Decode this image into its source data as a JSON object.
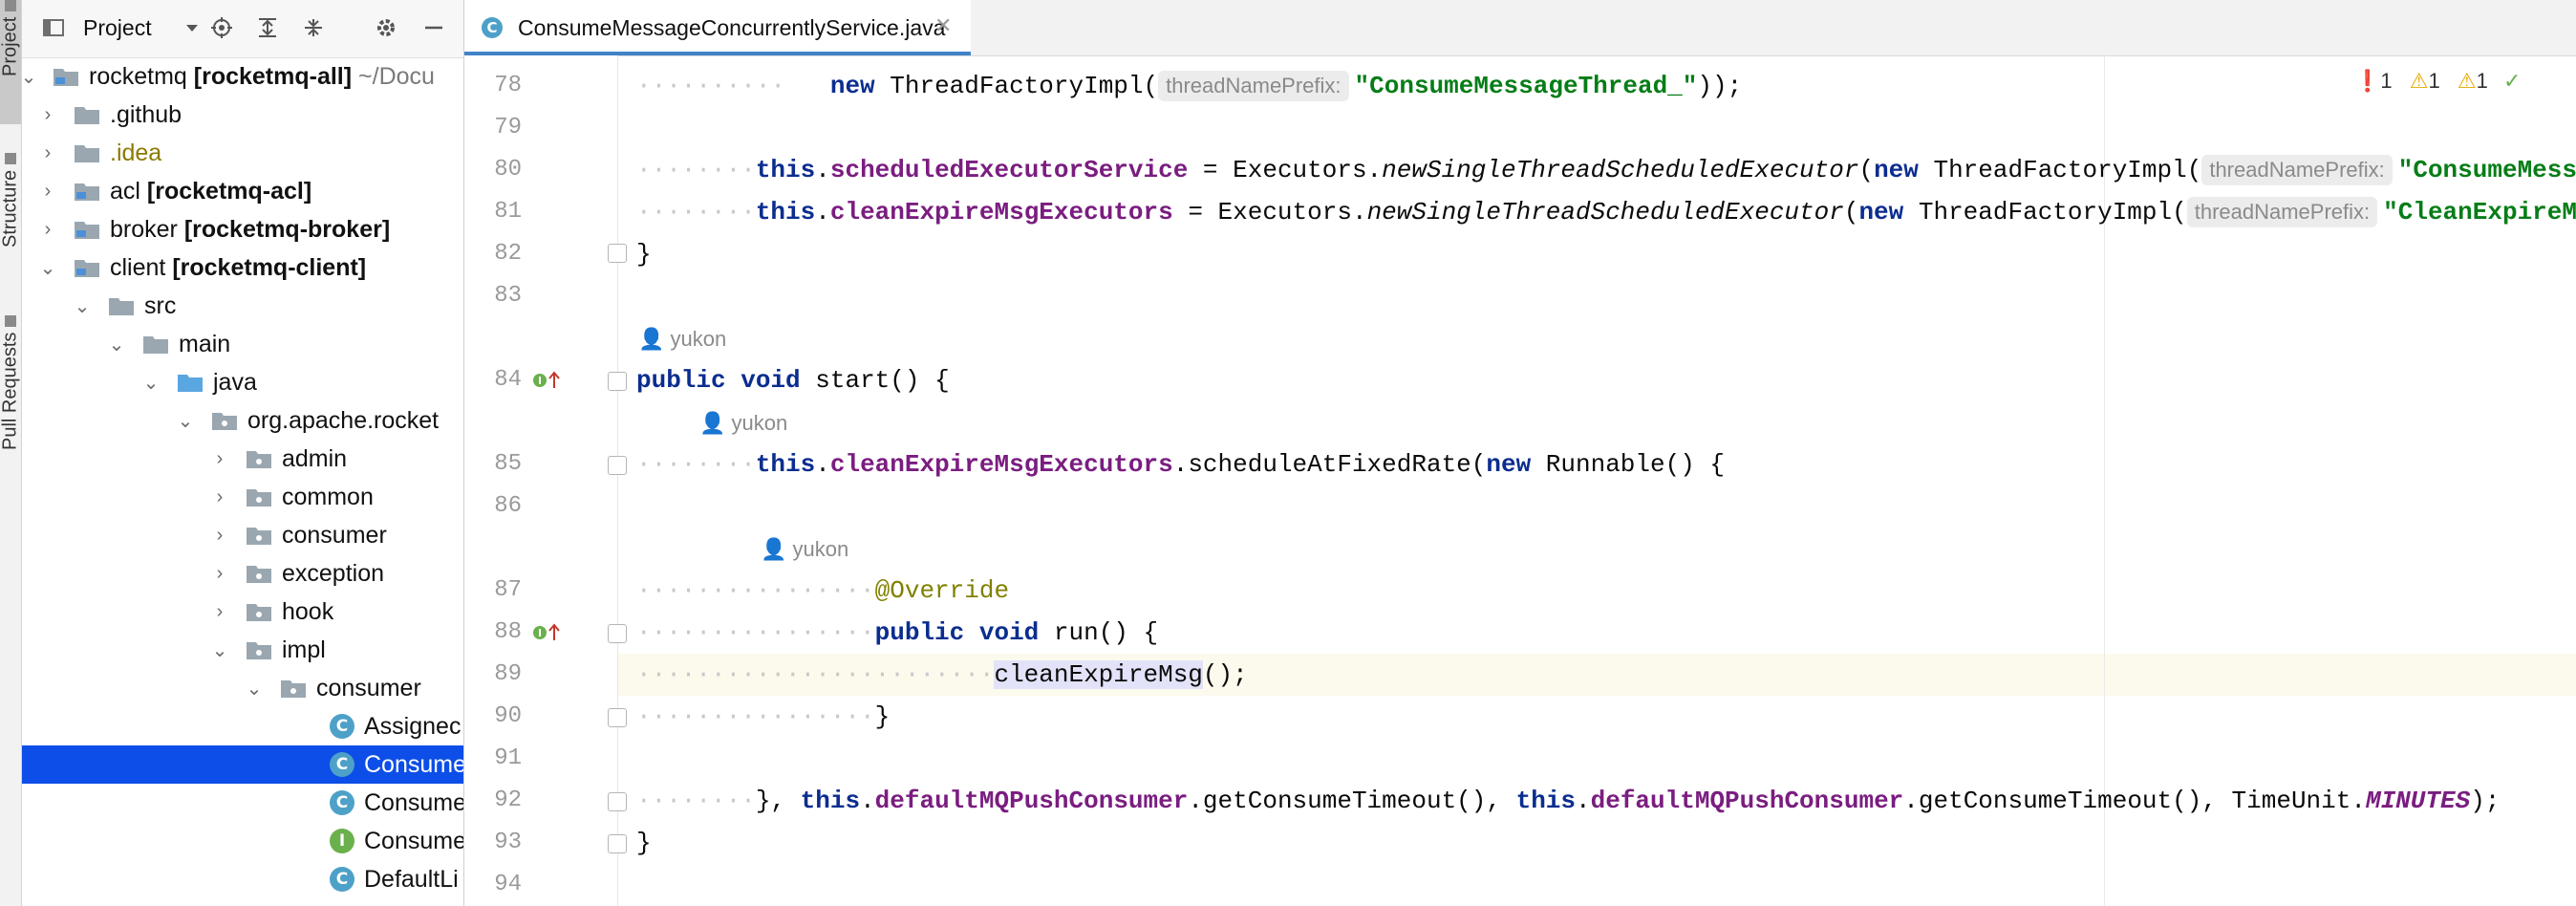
{
  "side_stripe": {
    "project_label": "Project",
    "structure_label": "Structure",
    "pull_requests_label": "Pull Requests"
  },
  "project_panel": {
    "title": "Project",
    "toolbar_icons": [
      "project-view-icon",
      "dropdown-icon",
      "locate-icon",
      "expand-all-icon",
      "collapse-all-icon",
      "gear-icon",
      "minimize-icon"
    ],
    "tree": {
      "root_name": "rocketmq",
      "root_module": "[rocketmq-all]",
      "root_path": "~/Docu",
      "github": ".github",
      "idea": ".idea",
      "acl_name": "acl",
      "acl_module": "[rocketmq-acl]",
      "broker_name": "broker",
      "broker_module": "[rocketmq-broker]",
      "client_name": "client",
      "client_module": "[rocketmq-client]",
      "src": "src",
      "main": "main",
      "java": "java",
      "pkg": "org.apache.rocket",
      "admin": "admin",
      "common": "common",
      "consumer": "consumer",
      "exception": "exception",
      "hook": "hook",
      "impl": "impl",
      "impl_consumer": "consumer",
      "cls1": "Assignec",
      "cls2": "Consume",
      "cls3": "Consume",
      "cls4": "Consume",
      "cls5": "DefaultLi"
    }
  },
  "editor": {
    "tab_label": "ConsumeMessageConcurrentlyService.java",
    "tab_icon_letter": "C",
    "inspections": {
      "errors": "1",
      "warnings": "1",
      "weak_warnings": "1"
    },
    "line_numbers": [
      "78",
      "79",
      "80",
      "81",
      "82",
      "83",
      "84",
      "85",
      "86",
      "87",
      "88",
      "89",
      "90",
      "91",
      "92",
      "93",
      "94"
    ],
    "authors": {
      "a84": "yukon",
      "a85": "yukon",
      "a87": "yukon"
    },
    "code": {
      "l78_new": "new",
      "l78_call": " ThreadFactoryImpl(",
      "l78_hint": "threadNamePrefix:",
      "l78_str": "\"ConsumeMessageThread_\"",
      "l78_tail": "));",
      "this": "this",
      "l80_field": "scheduledExecutorService",
      "l80_mid": " = Executors.",
      "l80_method": "newSingleThreadScheduledExecutor",
      "l80_open": "(",
      "new": "new",
      "l80_call": " ThreadFactoryImpl(",
      "l80_hint": "threadNamePrefix:",
      "l80_str": "\"ConsumeMess",
      "l81_field": "cleanExpireMsgExecutors",
      "l81_mid": " = Executors.",
      "l81_method": "newSingleThreadScheduledExecutor",
      "l81_call": " ThreadFactoryImpl(",
      "l81_hint": "threadNamePrefix:",
      "l81_str": "\"CleanExpireM",
      "l82": "}",
      "public": "public",
      "void": "void",
      "l84_sig": " start() {",
      "l85_field": "cleanExpireMsgExecutors",
      "l85_call": ".scheduleAtFixedRate(",
      "l85_tail": " Runnable() {",
      "l87": "@Override",
      "l88_sig": " run() {",
      "l89_call": "cleanExpireMsg",
      "l89_tail": "();",
      "l90": "}",
      "l92_start": "}, ",
      "l92_field": "defaultMQPushConsumer",
      "l92_call": ".getConsumeTimeout(), ",
      "l92_call2": ".getConsumeTimeout(), TimeUnit.",
      "l92_const": "MINUTES",
      "l92_tail": ");",
      "l93": "}"
    }
  }
}
